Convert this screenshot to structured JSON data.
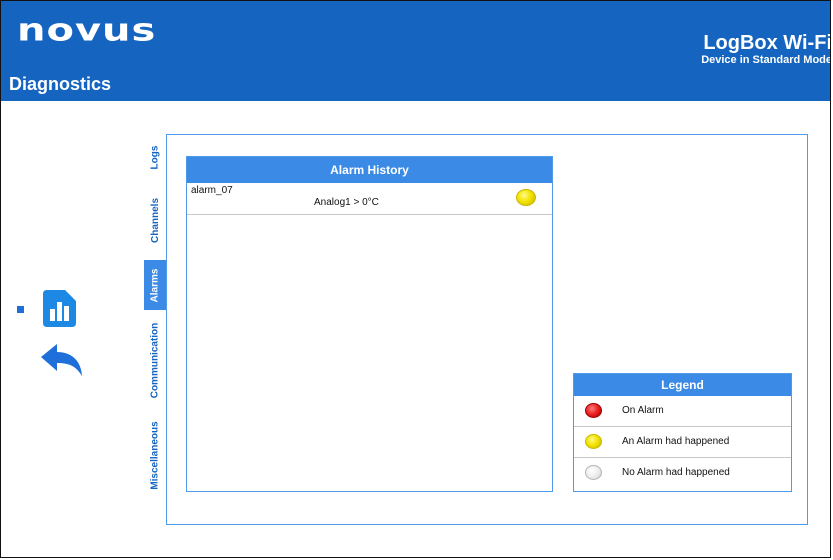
{
  "header": {
    "logo_text": "novus",
    "page_title": "Diagnostics",
    "device_title": "LogBox Wi-Fi",
    "device_mode": "Device in Standard Mode"
  },
  "tabs": [
    {
      "label": "Logs"
    },
    {
      "label": "Channels"
    },
    {
      "label": "Alarms",
      "active": true
    },
    {
      "label": "Communication"
    },
    {
      "label": "Miscellaneous"
    }
  ],
  "alarm_history": {
    "title": "Alarm History",
    "rows": [
      {
        "name": "alarm_07",
        "condition": "Analog1 > 0°C",
        "status": "had-happened"
      }
    ]
  },
  "legend": {
    "title": "Legend",
    "items": [
      {
        "label": "On Alarm",
        "status": "on",
        "color": "#e82020"
      },
      {
        "label": "An Alarm had happened",
        "status": "had-happened",
        "color": "#f3e400"
      },
      {
        "label": "No Alarm had happened",
        "status": "none",
        "color": "#ececec"
      }
    ]
  },
  "left_tools": {
    "chart_icon": "bar-chart-icon",
    "back_icon": "back-arrow-icon"
  },
  "colors": {
    "header_bg": "#1565c0",
    "panel_header_bg": "#3b8be6",
    "border": "#4f9bea"
  }
}
